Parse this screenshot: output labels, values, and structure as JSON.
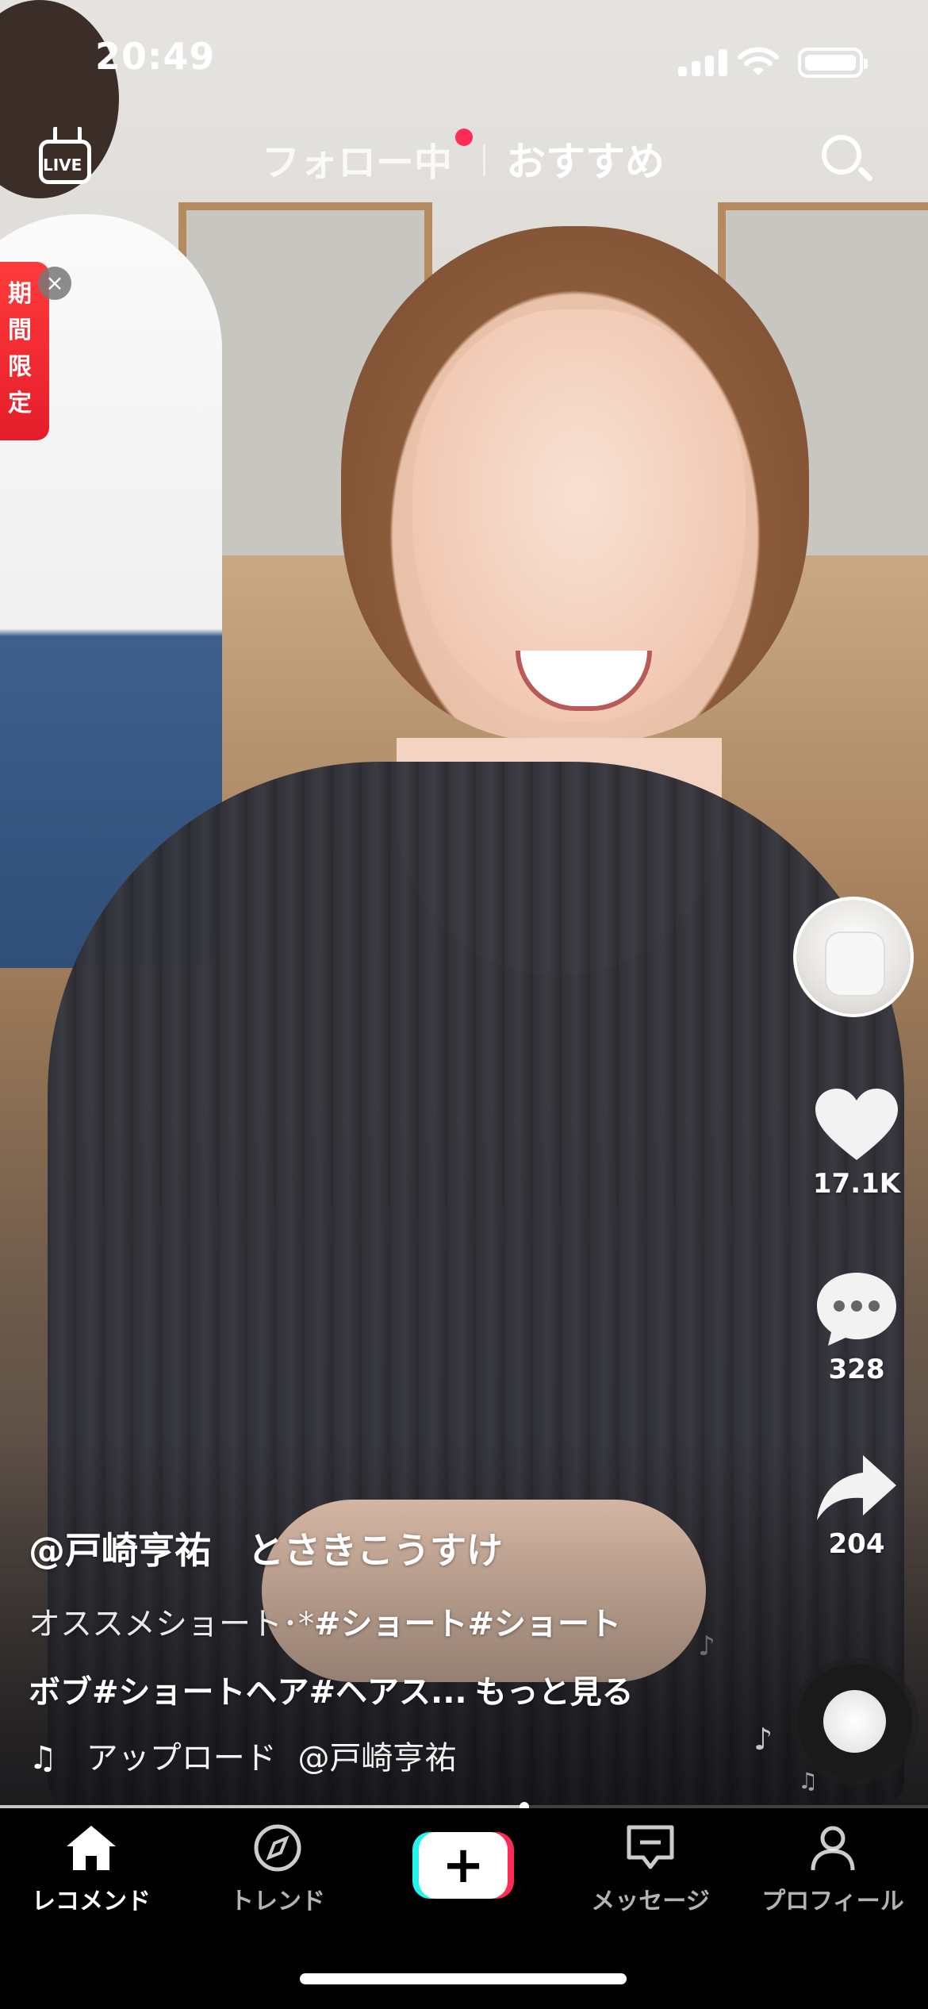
{
  "status_bar": {
    "time": "20:49"
  },
  "top_nav": {
    "live_label": "LIVE",
    "tab_following": "フォロー中",
    "tab_recommended": "おすすめ"
  },
  "promo": {
    "label": "期間限定",
    "close": "×"
  },
  "rail": {
    "likes": "17.1K",
    "comments": "328",
    "shares": "204"
  },
  "caption": {
    "username": "@戸崎亨祐　とさきこうすけ",
    "desc_plain": "オススメショート･*",
    "desc_tags_line1": "#ショート#ショート",
    "desc_tags_line2": "ボブ#ショートヘア#ヘアス...",
    "more": "もっと見る",
    "music_source": "アップロード",
    "music_author": "@戸崎亨祐"
  },
  "progress": {
    "fraction": 0.565
  },
  "bottom_nav": {
    "home": "レコメンド",
    "trend": "トレンド",
    "plus": "+",
    "messages": "メッセージ",
    "profile": "プロフィール"
  },
  "colors": {
    "accent_red": "#fe2c55",
    "accent_cyan": "#25f4ee",
    "promo_red": "#e51d2b"
  }
}
